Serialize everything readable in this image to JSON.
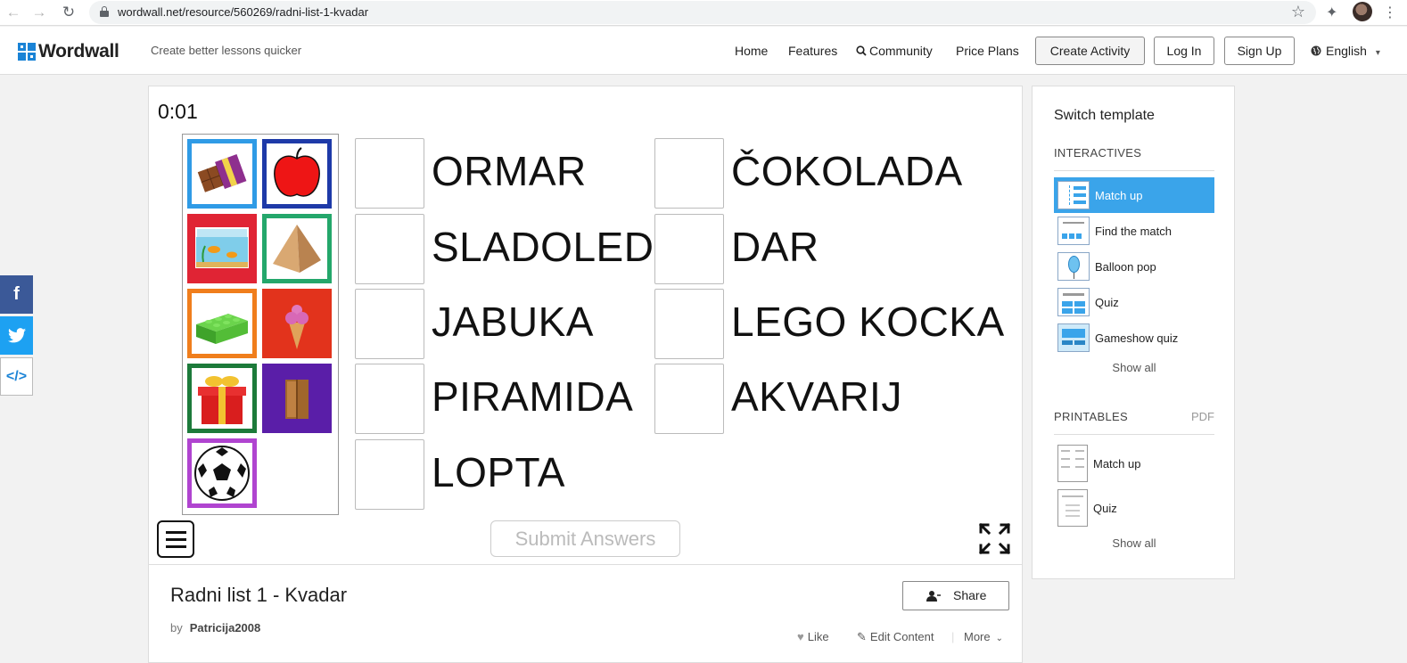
{
  "browser": {
    "url": "wordwall.net/resource/560269/radni-list-1-kvadar"
  },
  "header": {
    "logo_text": "Wordwall",
    "tagline": "Create better lessons quicker",
    "nav": {
      "home": "Home",
      "features": "Features",
      "community": "Community",
      "price_plans": "Price Plans"
    },
    "buttons": {
      "create_activity": "Create Activity",
      "log_in": "Log In",
      "sign_up": "Sign Up"
    },
    "language": "English"
  },
  "social": {
    "facebook_glyph": "f",
    "embed_glyph": "</>"
  },
  "game": {
    "timer": "0:01",
    "images": [
      "chocolate-bar",
      "apple",
      "aquarium",
      "pyramid",
      "lego-brick",
      "ice-cream",
      "gift",
      "wardrobe",
      "football"
    ],
    "words_left": [
      "ORMAR",
      "SLADOLED",
      "JABUKA",
      "PIRAMIDA",
      "LOPTA"
    ],
    "words_right": [
      "ČOKOLADA",
      "DAR",
      "LEGO KOCKA",
      "AKVARIJ"
    ],
    "submit_label": "Submit Answers"
  },
  "activity": {
    "title": "Radni list 1 - Kvadar",
    "by_label": "by",
    "author": "Patricija2008",
    "share_label": "Share",
    "like_label": "Like",
    "edit_label": "Edit Content",
    "more_label": "More"
  },
  "sidebar": {
    "title": "Switch template",
    "interactives_label": "INTERACTIVES",
    "interactives": [
      {
        "label": "Match up",
        "active": true
      },
      {
        "label": "Find the match",
        "active": false
      },
      {
        "label": "Balloon pop",
        "active": false
      },
      {
        "label": "Quiz",
        "active": false
      },
      {
        "label": "Gameshow quiz",
        "active": false
      }
    ],
    "show_all": "Show all",
    "printables_label": "PRINTABLES",
    "pdf_label": "PDF",
    "printables": [
      {
        "label": "Match up"
      },
      {
        "label": "Quiz"
      }
    ]
  },
  "colors": {
    "accent": "#3aa4ea",
    "logo_blue": "#1a83d6"
  }
}
